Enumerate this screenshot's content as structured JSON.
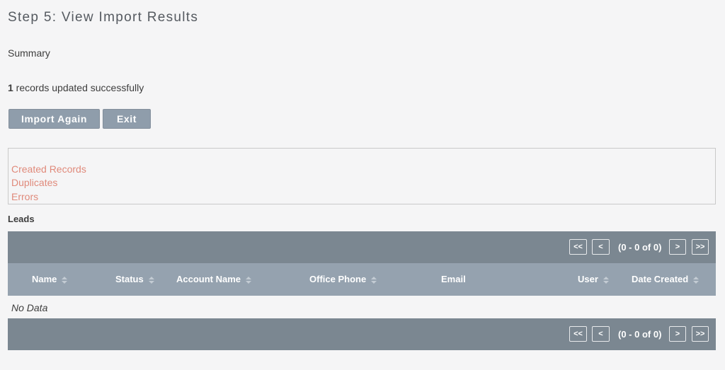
{
  "page": {
    "title": "Step 5: View Import Results",
    "summary_label": "Summary",
    "result": {
      "count": "1",
      "text": " records updated successfully"
    }
  },
  "buttons": {
    "import_again": "Import Again",
    "exit": "Exit"
  },
  "result_links": {
    "created": "Created Records",
    "duplicates": "Duplicates",
    "errors": "Errors"
  },
  "leads": {
    "label": "Leads",
    "pagination": {
      "first": "<<",
      "prev": "<",
      "count": "(0 - 0 of 0)",
      "next": ">",
      "last": ">>"
    },
    "columns": [
      {
        "label": "Name",
        "sortable": true
      },
      {
        "label": "Status",
        "sortable": true
      },
      {
        "label": "Account Name",
        "sortable": true
      },
      {
        "label": "Office Phone",
        "sortable": true
      },
      {
        "label": "Email",
        "sortable": false
      },
      {
        "label": "User",
        "sortable": true
      },
      {
        "label": "Date Created",
        "sortable": true
      }
    ],
    "empty_text": "No Data"
  },
  "colors": {
    "link": "#e08a7b",
    "button_bg": "#8f9dab",
    "pager_bg": "#7b8791",
    "header_bg": "#95a2af"
  }
}
